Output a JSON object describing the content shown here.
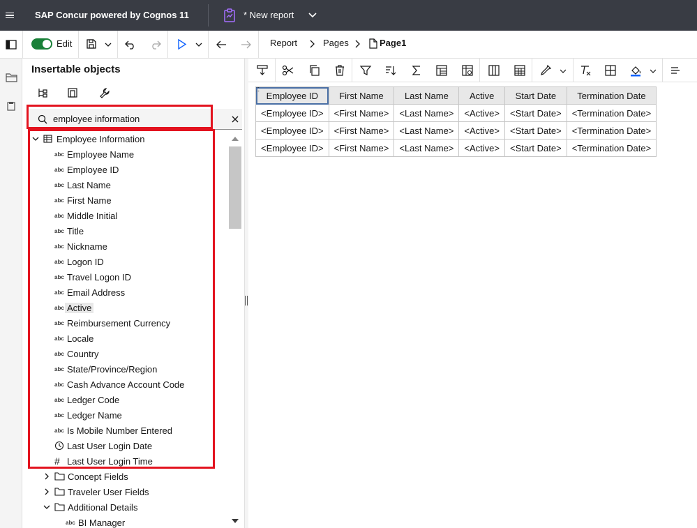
{
  "topbar": {
    "app_title": "SAP Concur powered by Cognos 11",
    "report_title": "* New report"
  },
  "toolbar": {
    "edit_label": "Edit",
    "breadcrumbs": [
      "Report",
      "Pages",
      "Page1"
    ]
  },
  "panel": {
    "title": "Insertable objects",
    "search_value": "employee information",
    "tree": [
      {
        "label": "Employee Information",
        "type": "table",
        "expanded": true
      },
      {
        "label": "Employee Name",
        "type": "abc"
      },
      {
        "label": "Employee ID",
        "type": "abc"
      },
      {
        "label": "Last Name",
        "type": "abc"
      },
      {
        "label": "First Name",
        "type": "abc"
      },
      {
        "label": "Middle Initial",
        "type": "abc"
      },
      {
        "label": "Title",
        "type": "abc"
      },
      {
        "label": "Nickname",
        "type": "abc"
      },
      {
        "label": "Logon ID",
        "type": "abc"
      },
      {
        "label": "Travel Logon ID",
        "type": "abc"
      },
      {
        "label": "Email Address",
        "type": "abc"
      },
      {
        "label": "Active",
        "type": "abc"
      },
      {
        "label": "Reimbursement Currency",
        "type": "abc"
      },
      {
        "label": "Locale",
        "type": "abc"
      },
      {
        "label": "Country",
        "type": "abc"
      },
      {
        "label": "State/Province/Region",
        "type": "abc"
      },
      {
        "label": "Cash Advance Account Code",
        "type": "abc"
      },
      {
        "label": "Ledger Code",
        "type": "abc"
      },
      {
        "label": "Ledger Name",
        "type": "abc"
      },
      {
        "label": "Is Mobile Number Entered",
        "type": "abc"
      },
      {
        "label": "Last User Login Date",
        "type": "clock"
      },
      {
        "label": "Last User Login Time",
        "type": "hash"
      },
      {
        "label": "Concept Fields",
        "type": "folder"
      },
      {
        "label": "Traveler User Fields",
        "type": "folder"
      },
      {
        "label": "Additional Details",
        "type": "folder-open"
      },
      {
        "label": "BI Manager",
        "type": "abc-child"
      }
    ]
  },
  "report_table": {
    "headers": [
      "Employee ID",
      "First Name",
      "Last Name",
      "Active",
      "Start Date",
      "Termination Date"
    ],
    "rows": [
      [
        "<Employee ID>",
        "<First Name>",
        "<Last Name>",
        "<Active>",
        "<Start Date>",
        "<Termination Date>"
      ],
      [
        "<Employee ID>",
        "<First Name>",
        "<Last Name>",
        "<Active>",
        "<Start Date>",
        "<Termination Date>"
      ],
      [
        "<Employee ID>",
        "<First Name>",
        "<Last Name>",
        "<Active>",
        "<Start Date>",
        "<Termination Date>"
      ]
    ]
  },
  "colors": {
    "topbar_bg": "#393c44",
    "toggle_on": "#198038",
    "highlight_red": "#e3131f",
    "selection_blue": "#4a6fa5",
    "toolbar_icon_blue": "#0f62fe",
    "report_icon_purple": "#8a3ffc"
  }
}
